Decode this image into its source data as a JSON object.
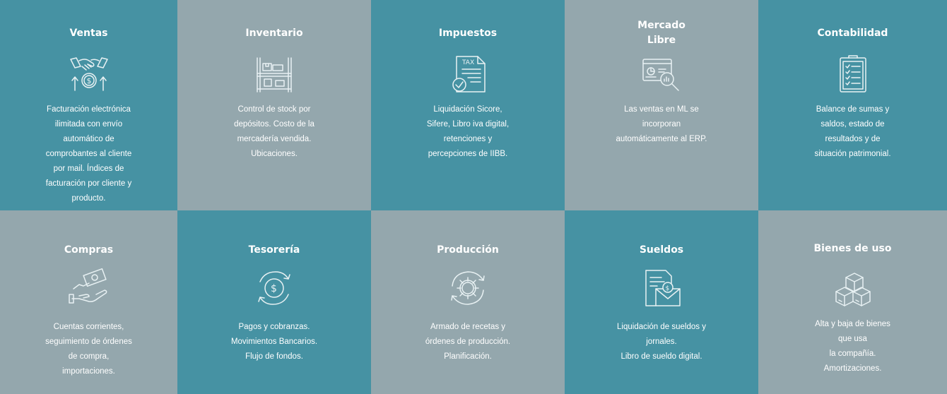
{
  "modules": [
    {
      "title": "Ventas",
      "icon": "handshake-coin-icon",
      "description": "Facturación electrónica\nilimitada con envío\nautomático de\ncomprobantes al cliente\npor mail. Índices de\nfacturación por cliente y\nproducto."
    },
    {
      "title": "Inventario",
      "icon": "warehouse-shelf-icon",
      "description": "Control de stock por\ndepósitos. Costo de la\nmercadería vendida.\nUbicaciones."
    },
    {
      "title": "Impuestos",
      "icon": "tax-document-icon",
      "icon_text": "TAX",
      "description": "Liquidación Sicore,\nSifere, Libro iva digital,\nretenciones y\npercepciones de IIBB."
    },
    {
      "title": "Mercado\nLibre",
      "icon": "dashboard-magnifier-icon",
      "description": "Las ventas en ML se\nincorporan\nautomáticamente al ERP."
    },
    {
      "title": "Contabilidad",
      "icon": "clipboard-checklist-icon",
      "description": "Balance de sumas y\nsaldos, estado de\nresultados y de\nsituación patrimonial."
    },
    {
      "title": "Compras",
      "icon": "hand-money-icon",
      "description": "Cuentas corrientes,\nseguimiento de órdenes\nde compra,\nimportaciones."
    },
    {
      "title": "Tesorería",
      "icon": "dollar-cycle-icon",
      "description": "Pagos y cobranzas.\nMovimientos Bancarios.\nFlujo de fondos."
    },
    {
      "title": "Producción",
      "icon": "gear-cycle-icon",
      "description": "Armado de recetas y\nórdenes de producción.\nPlanificación."
    },
    {
      "title": "Sueldos",
      "icon": "payroll-envelope-icon",
      "description": "Liquidación de sueldos y\njornales.\nLibro de sueldo digital."
    },
    {
      "title": "Bienes de uso",
      "icon": "stacked-boxes-icon",
      "description": "Alta y baja de bienes\nque usa\nla compañía.\nAmortizaciones."
    }
  ],
  "colors": {
    "teal": "#4692a3",
    "gray": "#94a7ad",
    "text": "#ffffff"
  }
}
